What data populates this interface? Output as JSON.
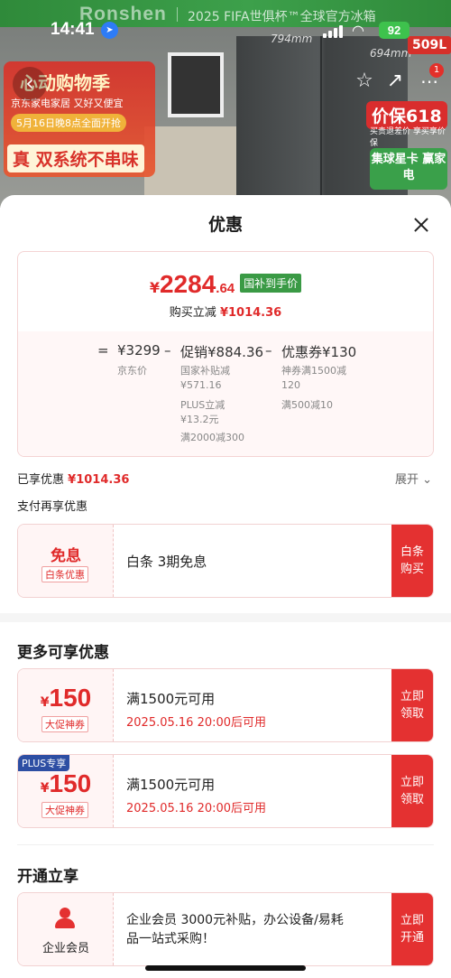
{
  "status_bar": {
    "time": "14:41",
    "battery": "92"
  },
  "background": {
    "brand": "Ronshen",
    "slogan": "2025 FIFA世俱杯™全球官方冰箱",
    "dim_width": "794mm",
    "dim_depth": "694mm",
    "capacity": "509L",
    "promo_title": "心动购物季",
    "promo_sub": "京东家电家居 又好又便宜",
    "promo_date": "5月16日晚8点全面开抢",
    "promo_tag": "真 双系统不串味",
    "badge_618": "价保618",
    "badge_618_sub": "买贵退差价 享买享价保",
    "badge_star": "集球星卡 赢家电",
    "msg_badge": "1"
  },
  "sheet": {
    "title": "优惠",
    "price": {
      "symbol": "¥",
      "integer": "2284",
      "decimal": ".64",
      "tag": "国补到手价",
      "sub_label": "购买立减",
      "sub_value": "¥1014.36"
    },
    "calc": {
      "eq": "=",
      "base": "¥3299",
      "minus1": "–",
      "promo": "促销¥884.36",
      "minus2": "–",
      "coupon": "优惠券¥130",
      "base_note": "京东价",
      "promo_notes": [
        "国家补贴减",
        "¥571.16",
        "PLUS立减",
        "¥13.2元",
        "满2000减300"
      ],
      "coupon_notes": [
        "神券满1500减",
        "120",
        "满500减10"
      ]
    },
    "enjoyed_label": "已享优惠",
    "enjoyed_value": "¥1014.36",
    "expand_label": "展开",
    "pay_label": "支付再享优惠",
    "pay_coupon": {
      "title": "免息",
      "badge": "白条优惠",
      "desc": "白条 3期免息",
      "btn_line1": "白条",
      "btn_line2": "购买"
    },
    "more_title": "更多可享优惠",
    "coupons": [
      {
        "symbol": "¥",
        "amount": "150",
        "badge": "大促神券",
        "condition": "满1500元可用",
        "valid": "2025.05.16 20:00后可用",
        "btn_line1": "立即",
        "btn_line2": "领取"
      },
      {
        "plus_tag": "PLUS专享",
        "symbol": "¥",
        "amount": "150",
        "badge": "大促神券",
        "condition": "满1500元可用",
        "valid": "2025.05.16 20:00后可用",
        "btn_line1": "立即",
        "btn_line2": "领取"
      }
    ],
    "open_title": "开通立享",
    "member": {
      "label": "企业会员",
      "desc_line1": "企业会员 3000元补贴，办公设备/易耗",
      "desc_line2": "品一站式采购！",
      "btn_line1": "立即",
      "btn_line2": "开通"
    }
  },
  "colors": {
    "accent_red": "#e43131",
    "price_red": "#e02a2a",
    "gov_green": "#3a9a45",
    "plus_blue": "#2d4ea3"
  }
}
